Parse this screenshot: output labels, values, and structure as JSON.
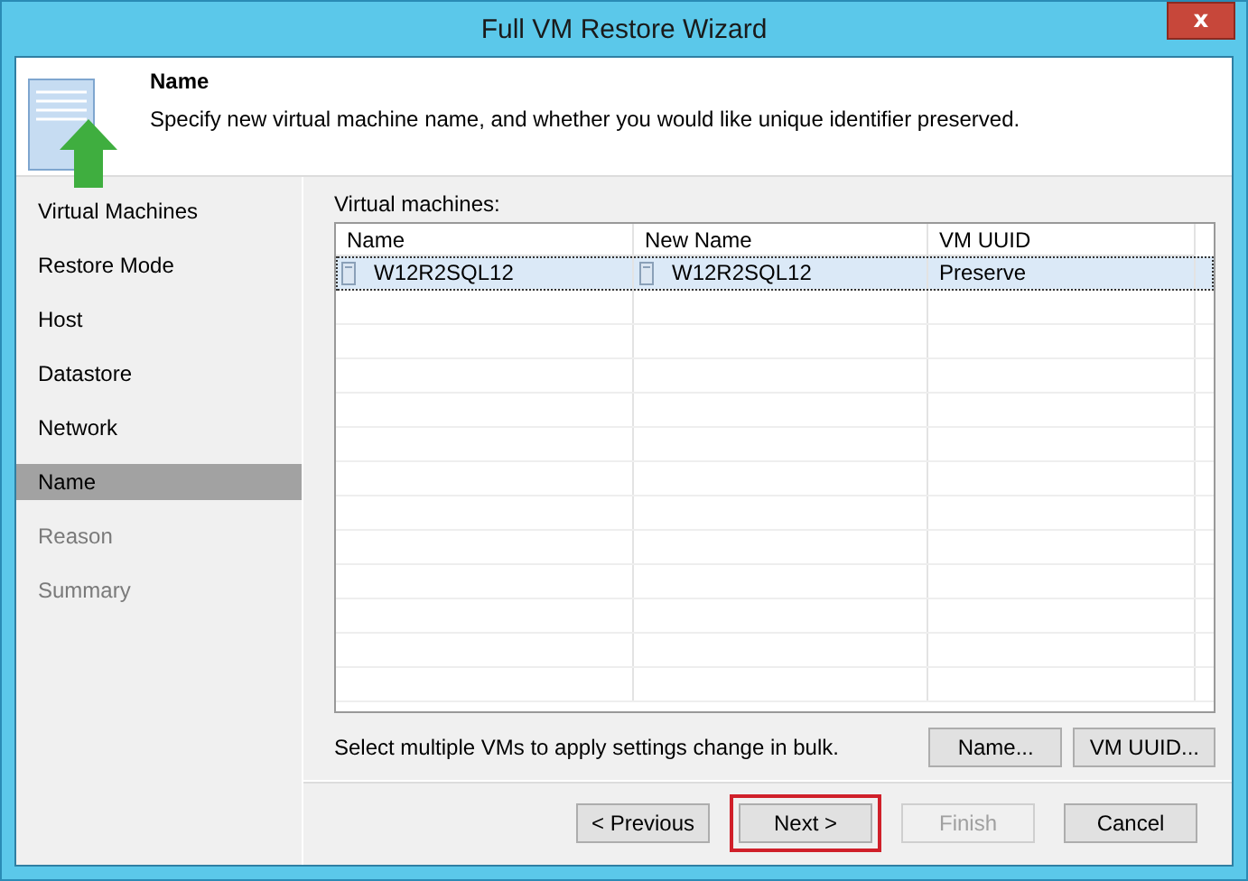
{
  "window": {
    "title": "Full VM Restore Wizard",
    "close": "x"
  },
  "header": {
    "title": "Name",
    "description": "Specify new virtual machine name, and whether you would like unique identifier preserved."
  },
  "steps": [
    {
      "label": "Virtual Machines",
      "selected": false,
      "disabled": false
    },
    {
      "label": "Restore Mode",
      "selected": false,
      "disabled": false
    },
    {
      "label": "Host",
      "selected": false,
      "disabled": false
    },
    {
      "label": "Datastore",
      "selected": false,
      "disabled": false
    },
    {
      "label": "Network",
      "selected": false,
      "disabled": false
    },
    {
      "label": "Name",
      "selected": true,
      "disabled": false
    },
    {
      "label": "Reason",
      "selected": false,
      "disabled": true
    },
    {
      "label": "Summary",
      "selected": false,
      "disabled": true
    }
  ],
  "table": {
    "label": "Virtual machines:",
    "columns": [
      "Name",
      "New Name",
      "VM UUID"
    ],
    "rows": [
      {
        "name": "W12R2SQL12",
        "new_name": "W12R2SQL12",
        "vm_uuid": "Preserve",
        "selected": true
      }
    ]
  },
  "hint": "Select multiple VMs to apply settings change in bulk.",
  "table_buttons": [
    {
      "label": "Name..."
    },
    {
      "label": "VM UUID..."
    }
  ],
  "footer_buttons": [
    {
      "label": "< Previous",
      "disabled": false,
      "highlighted": false
    },
    {
      "label": "Next >",
      "disabled": false,
      "highlighted": true
    },
    {
      "label": "Finish",
      "disabled": true,
      "highlighted": false
    },
    {
      "label": "Cancel",
      "disabled": false,
      "highlighted": false
    }
  ]
}
